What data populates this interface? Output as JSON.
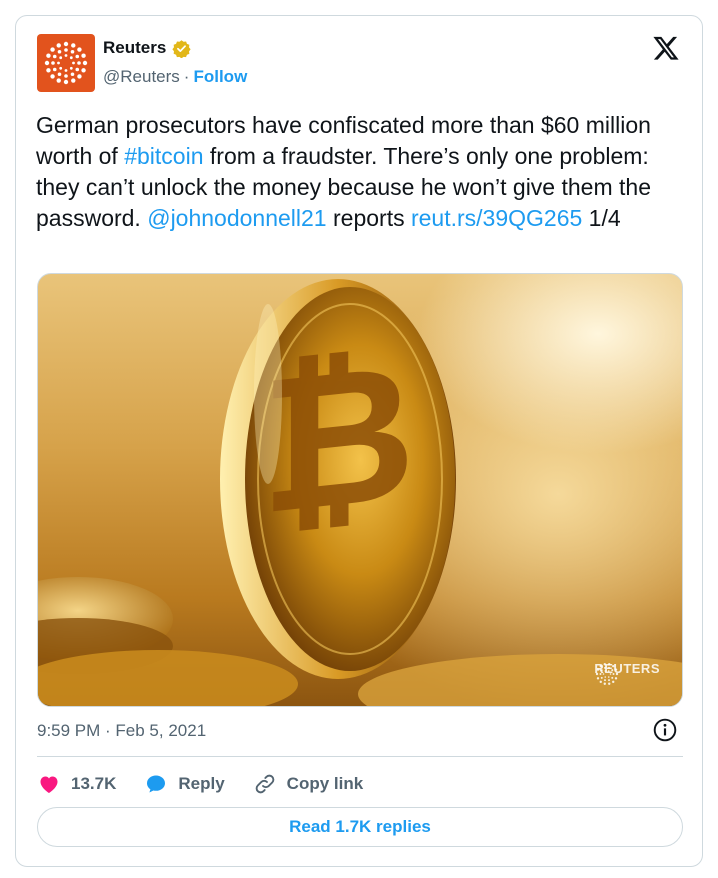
{
  "author": {
    "name": "Reuters",
    "handle": "@Reuters",
    "separator": "·",
    "follow_label": "Follow",
    "avatar_icon": "reuters-logo-icon",
    "verified_icon": "verified-badge-icon",
    "brand_color": "#e2531d"
  },
  "platform_icon": "x-logo-icon",
  "tweet": {
    "text_part1": "German prosecutors have confiscated more than $60 million worth of ",
    "hashtag": "#bitcoin",
    "text_part2": " from a fraudster. There’s only one problem: they can’t unlock the money because he won’t give them the password. ",
    "mention": "@johnodonnell21",
    "text_part3": " reports ",
    "link": "reut.rs/39QG265",
    "text_part4": " 1/4",
    "link_color": "#1d9bf0"
  },
  "media": {
    "description_icon": "bitcoin-photo",
    "watermark": "REUTERS"
  },
  "meta": {
    "timestamp": "9:59 PM · Feb 5, 2021",
    "info_icon": "info-icon"
  },
  "actions": {
    "like_icon": "heart-icon",
    "like_count": "13.7K",
    "reply_icon": "reply-bubble-icon",
    "reply_label": "Reply",
    "copy_icon": "link-icon",
    "copy_label": "Copy link",
    "like_color": "#f91880"
  },
  "replies_button": {
    "label": "Read 1.7K replies"
  }
}
